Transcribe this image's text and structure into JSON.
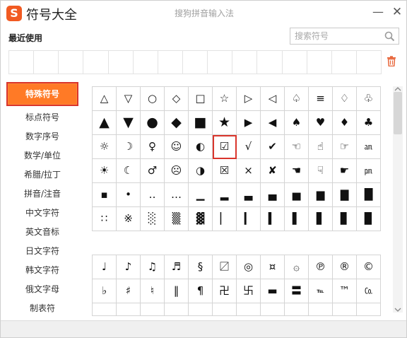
{
  "app": {
    "logo_letter": "S",
    "title": "符号大全",
    "window_title": "搜狗拼音输入法",
    "minimize_label": "—",
    "close_label": "✕"
  },
  "recent": {
    "label": "最近使用",
    "cells": 15
  },
  "search": {
    "placeholder": "搜索符号",
    "value": ""
  },
  "sidebar": {
    "items": [
      {
        "label": "特殊符号",
        "active": true
      },
      {
        "label": "标点符号"
      },
      {
        "label": "数字序号"
      },
      {
        "label": "数学/单位"
      },
      {
        "label": "希腊/拉丁"
      },
      {
        "label": "拼音/注音"
      },
      {
        "label": "中文字符"
      },
      {
        "label": "英文音标"
      },
      {
        "label": "日文字符"
      },
      {
        "label": "韩文字符"
      },
      {
        "label": "俄文字母"
      },
      {
        "label": "制表符"
      }
    ]
  },
  "grid1": {
    "symbols": [
      "△",
      "▽",
      "○",
      "◇",
      "□",
      "☆",
      "▷",
      "◁",
      "♤",
      "≡",
      "♢",
      "♧",
      "▲",
      "▼",
      "●",
      "◆",
      "■",
      "★",
      "▶",
      "◀",
      "♠",
      "♥",
      "♦",
      "♣",
      "☼",
      "☽",
      "♀",
      "☺",
      "◐",
      "☑",
      "√",
      "✔",
      "☜",
      "☝",
      "☞",
      "㏂",
      "☀",
      "☾",
      "♂",
      "☹",
      "◑",
      "☒",
      "×",
      "✘",
      "☚",
      "☟",
      "☛",
      "㏘",
      "▪",
      "•",
      "‥",
      "…",
      "▁",
      "▂",
      "▃",
      "▄",
      "▅",
      "▆",
      "▇",
      "█",
      "∷",
      "※",
      "░",
      "▒",
      "▓",
      "▏",
      "▎",
      "▍",
      "▌",
      "▋",
      "▊",
      "▉"
    ],
    "selected_index": 29
  },
  "grid2": {
    "symbols": [
      "♩",
      "♪",
      "♫",
      "♬",
      "§",
      "〼",
      "◎",
      "¤",
      "۞",
      "℗",
      "®",
      "©",
      "♭",
      "♯",
      "♮",
      "‖",
      "¶",
      "卍",
      "卐",
      "▬",
      "〓",
      "℡",
      "™",
      "㏇",
      "",
      "",
      "",
      "",
      "",
      "",
      "",
      "",
      "",
      "",
      "",
      ""
    ]
  },
  "colors": {
    "accent": "#ff7a26",
    "highlight_border": "#d9352c",
    "logo_bg": "#f15a22",
    "trash": "#e8673c"
  },
  "icons": {
    "search": "search-icon",
    "trash": "trash-icon"
  }
}
